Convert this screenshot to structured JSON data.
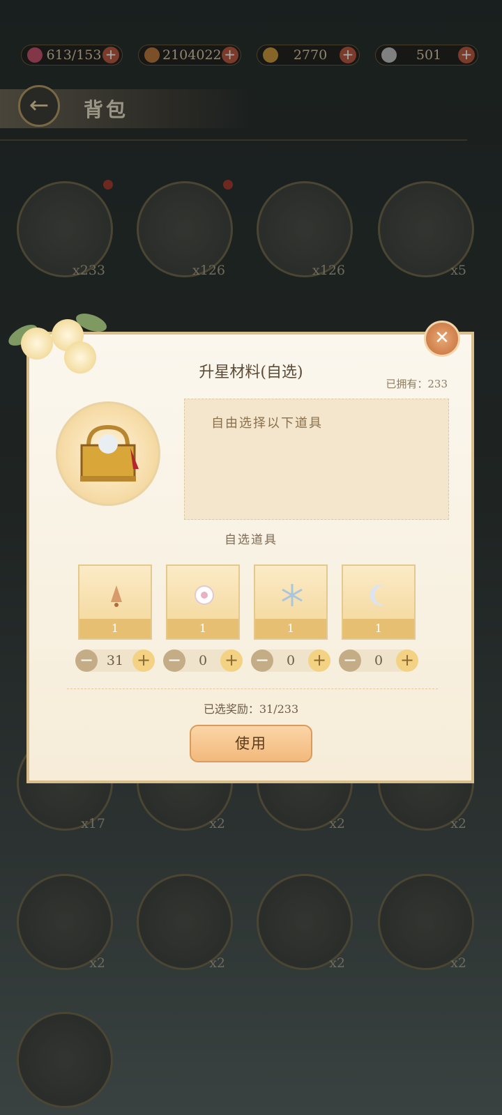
{
  "currencies": [
    {
      "name": "stamina",
      "icon": "lotus-icon",
      "value": "613/153",
      "color": "#c34f6a"
    },
    {
      "name": "coins",
      "icon": "coin-icon",
      "value": "2104022",
      "color": "#b8763a"
    },
    {
      "name": "tickets",
      "icon": "ticket-icon",
      "value": "2770",
      "color": "#c9953a"
    },
    {
      "name": "silver",
      "icon": "silver-icon",
      "value": "501",
      "color": "#bfbfbf"
    }
  ],
  "header": {
    "title": "背包"
  },
  "bag": {
    "row1": [
      {
        "count": "x233"
      },
      {
        "count": "x126"
      },
      {
        "count": "x126"
      },
      {
        "count": "x5"
      }
    ],
    "row5": [
      {
        "count": "x17"
      },
      {
        "count": "x2"
      },
      {
        "count": "x2"
      },
      {
        "count": "x2"
      }
    ],
    "row6": [
      {
        "count": "x2"
      },
      {
        "count": "x2"
      },
      {
        "count": "x2"
      },
      {
        "count": "x2"
      }
    ]
  },
  "modal": {
    "title": "升星材料(自选)",
    "owned": "已拥有：233",
    "description": "自由选择以下道具",
    "subtitle": "自选道具",
    "options": [
      {
        "icon": "bell-icon",
        "num": "1",
        "qty": "31"
      },
      {
        "icon": "peony-icon",
        "num": "1",
        "qty": "0"
      },
      {
        "icon": "snowflake-icon",
        "num": "1",
        "qty": "0"
      },
      {
        "icon": "moon-icon",
        "num": "1",
        "qty": "0"
      }
    ],
    "selected": "已选奖励：31/233",
    "use_label": "使用"
  },
  "colors": {
    "accent": "#e7bf73",
    "plus": "#b8553b",
    "button": "#f2b97c"
  }
}
